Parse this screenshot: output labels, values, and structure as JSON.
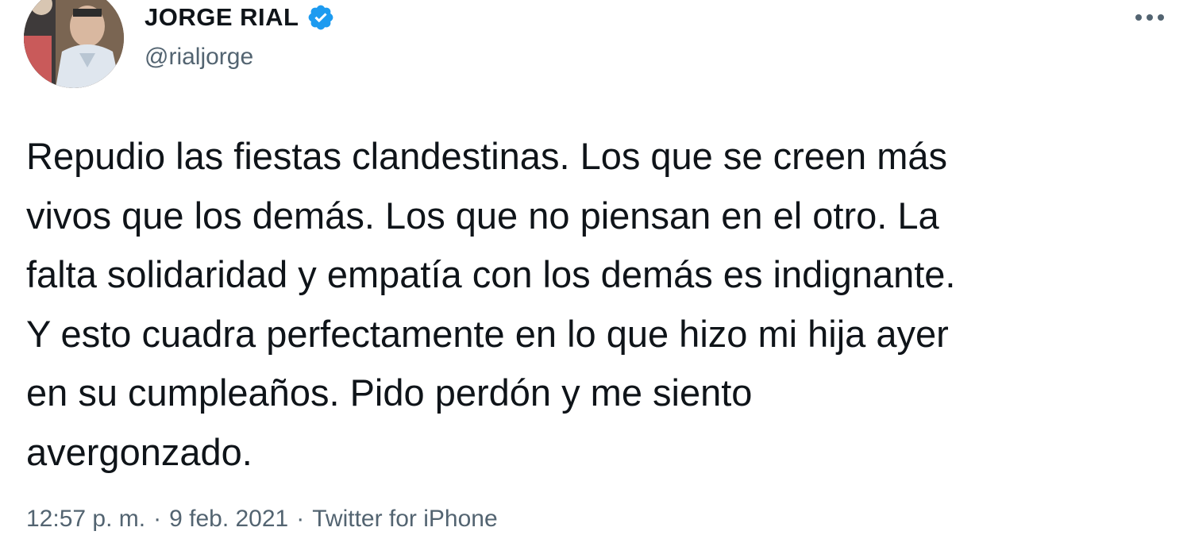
{
  "tweet": {
    "author": {
      "display_name": "JORGE RIAL",
      "handle": "@rialjorge",
      "verified": true,
      "avatar_icon": "profile-photo"
    },
    "text": "Repudio las fiestas clandestinas. Los que se creen más\nvivos que los demás. Los que no piensan en el otro. La\nfalta solidaridad y empatía con los demás es indignante.\nY esto cuadra perfectamente en lo que hizo mi hija ayer\nen su cumpleaños. Pido perdón y me siento\navergonzado.",
    "time": "12:57 p. m.",
    "date": "9 feb. 2021",
    "separator": "·",
    "source": "Twitter for iPhone",
    "more_icon": "more-horizontal-icon"
  },
  "colors": {
    "text": "#0f1419",
    "secondary": "#536471",
    "verified": "#1d9bf0",
    "background": "#ffffff"
  }
}
